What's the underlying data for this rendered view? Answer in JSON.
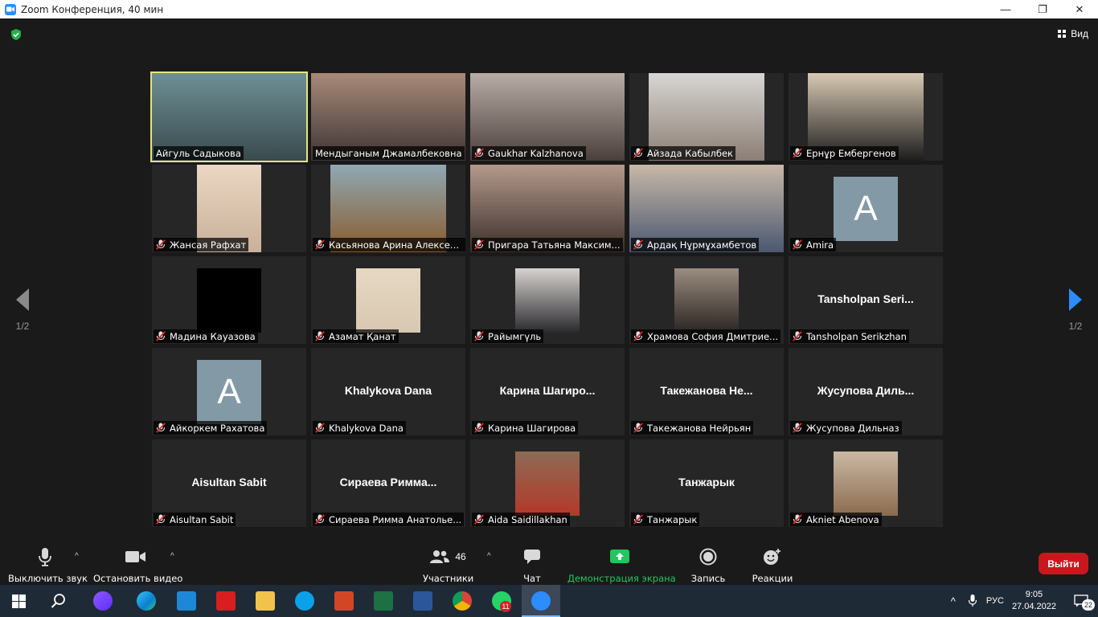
{
  "window": {
    "title": "Zoom Конференция, 40 мин",
    "minimize": "—",
    "restore": "❐",
    "close": "✕"
  },
  "header": {
    "view_label": "Вид"
  },
  "paging": {
    "left_page": "1/2",
    "right_page": "1/2"
  },
  "participants": [
    {
      "name": "Айгуль Садыкова",
      "muted": false,
      "active": true,
      "kind": "video",
      "colors": [
        "#6e8f95",
        "#3a4a4d"
      ]
    },
    {
      "name": "Мендыганым Джамалбековна",
      "muted": false,
      "kind": "video",
      "colors": [
        "#a88a7a",
        "#3d3535"
      ]
    },
    {
      "name": "Gaukhar Kalzhanova",
      "muted": true,
      "kind": "video",
      "colors": [
        "#b9aea6",
        "#4a3f3b"
      ]
    },
    {
      "name": "Айзада Кабылбек",
      "muted": true,
      "kind": "video",
      "colors": [
        "#d8d6d4",
        "#8b7e74"
      ]
    },
    {
      "name": "Ернұр Ембергенов",
      "muted": true,
      "kind": "video",
      "colors": [
        "#d8c9b3",
        "#1d1d1d"
      ]
    },
    {
      "name": "Жансая Рафхат",
      "muted": true,
      "kind": "video",
      "colors": [
        "#ead7c2",
        "#c9b09a"
      ]
    },
    {
      "name": "Касьянова Арина Алексее...",
      "muted": true,
      "kind": "video",
      "colors": [
        "#8fa9b4",
        "#8a5a2c"
      ]
    },
    {
      "name": "Пригара Татьяна Максим...",
      "muted": true,
      "kind": "video",
      "colors": [
        "#b49a8c",
        "#3b2f2b"
      ]
    },
    {
      "name": "Ардақ Нұрмұхамбетов",
      "muted": true,
      "kind": "video",
      "colors": [
        "#c8b8a8",
        "#4a5870"
      ]
    },
    {
      "name": "Amira",
      "muted": true,
      "kind": "avatar",
      "letter": "A"
    },
    {
      "name": "Мадина Кауазова",
      "muted": true,
      "kind": "video",
      "colors": [
        "#000000",
        "#000000"
      ]
    },
    {
      "name": "Азамат Қанат",
      "muted": true,
      "kind": "video",
      "colors": [
        "#e6d8c3",
        "#d8c8b1"
      ]
    },
    {
      "name": "Райымгүль",
      "muted": true,
      "kind": "video",
      "colors": [
        "#d7d2cf",
        "#2a2a2e"
      ]
    },
    {
      "name": "Храмова София Дмитрие...",
      "muted": true,
      "kind": "video",
      "colors": [
        "#9a8c80",
        "#2b2523"
      ]
    },
    {
      "name": "Tansholpan Serikzhan",
      "muted": true,
      "kind": "text",
      "display": "Tansholpan  Seri..."
    },
    {
      "name": "Айкоркем Рахатова",
      "muted": true,
      "kind": "avatar",
      "letter": "A"
    },
    {
      "name": "Khalykova Dana",
      "muted": true,
      "kind": "text",
      "display": "Khalykova Dana"
    },
    {
      "name": "Карина Шагирова",
      "muted": true,
      "kind": "text",
      "display": "Карина  Шагиро..."
    },
    {
      "name": "Такежанова Нейрьян",
      "muted": true,
      "kind": "text",
      "display": "Такежанова  Не..."
    },
    {
      "name": "Жусупова Дильназ",
      "muted": true,
      "kind": "text",
      "display": "Жусупова  Диль..."
    },
    {
      "name": "Aisultan Sabit",
      "muted": true,
      "kind": "text",
      "display": "Aisultan Sabit"
    },
    {
      "name": "Сираева Римма Анатолье...",
      "muted": true,
      "kind": "text",
      "display": "Сираева  Римма..."
    },
    {
      "name": "Aida Saidillakhan",
      "muted": true,
      "kind": "video",
      "colors": [
        "#8c6b55",
        "#b5382a"
      ]
    },
    {
      "name": "Танжарык",
      "muted": true,
      "kind": "text",
      "display": "Танжарык"
    },
    {
      "name": "Akniet Abenova",
      "muted": true,
      "kind": "video",
      "colors": [
        "#cbb9a4",
        "#8a6b4f"
      ]
    }
  ],
  "toolbar": {
    "mute_label": "Выключить звук",
    "video_label": "Остановить видео",
    "participants_label": "Участники",
    "participants_count": "46",
    "chat_label": "Чат",
    "share_label": "Демонстрация экрана",
    "record_label": "Запись",
    "reactions_label": "Реакции",
    "leave_label": "Выйти",
    "share_color": "#22c55e",
    "leave_color": "#c9171e"
  },
  "taskbar": {
    "lang": "РУС",
    "time": "9:05",
    "date": "27.04.2022",
    "notifications": "22",
    "whatsapp_badge": "11",
    "apps": [
      "windows-start",
      "search",
      "alice",
      "edge",
      "mail",
      "acrobat",
      "explorer",
      "skype",
      "powerpoint",
      "excel",
      "word",
      "chrome",
      "whatsapp",
      "zoom"
    ]
  }
}
